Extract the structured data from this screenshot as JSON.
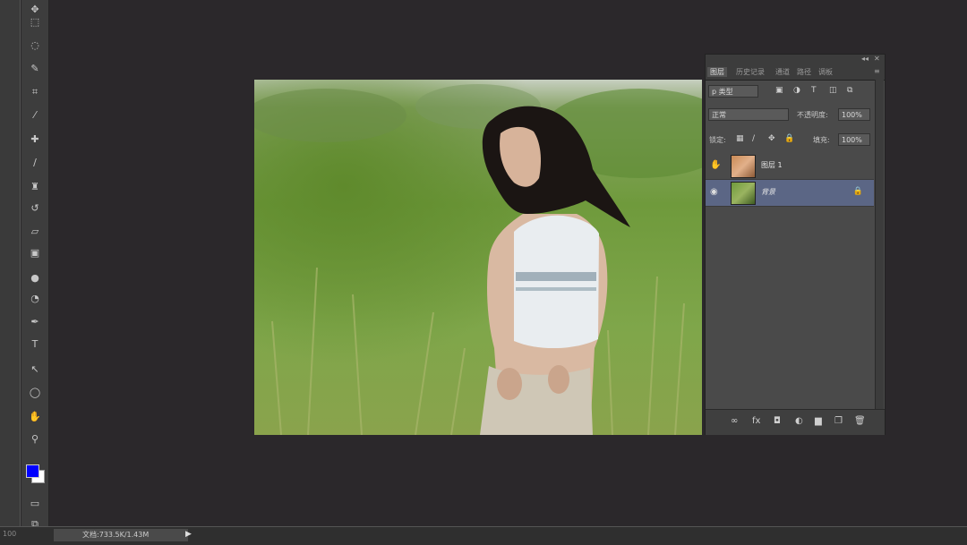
{
  "tools": [
    {
      "icon": "move-icon",
      "glyph": "✥"
    },
    {
      "icon": "marquee-icon",
      "glyph": "⬚"
    },
    {
      "icon": "lasso-icon",
      "glyph": "◌"
    },
    {
      "icon": "quick-select-icon",
      "glyph": "✎"
    },
    {
      "icon": "crop-icon",
      "glyph": "⌗"
    },
    {
      "icon": "eyedropper-icon",
      "glyph": "⁄"
    },
    {
      "icon": "spot-heal-icon",
      "glyph": "✚"
    },
    {
      "icon": "brush-icon",
      "glyph": "∕"
    },
    {
      "icon": "clone-stamp-icon",
      "glyph": "♜"
    },
    {
      "icon": "history-brush-icon",
      "glyph": "↺"
    },
    {
      "icon": "eraser-icon",
      "glyph": "▱"
    },
    {
      "icon": "gradient-icon",
      "glyph": "▣"
    },
    {
      "icon": "blur-icon",
      "glyph": "●"
    },
    {
      "icon": "dodge-icon",
      "glyph": "◔"
    },
    {
      "icon": "pen-icon",
      "glyph": "✒"
    },
    {
      "icon": "type-icon",
      "glyph": "T"
    },
    {
      "icon": "path-select-icon",
      "glyph": "↖"
    },
    {
      "icon": "shape-icon",
      "glyph": "◯"
    },
    {
      "icon": "hand-icon",
      "glyph": "✋"
    },
    {
      "icon": "zoom-icon",
      "glyph": "⚲"
    }
  ],
  "colors": {
    "foreground": "#0000ff",
    "background": "#ffffff",
    "selected_layer": "#5b6685"
  },
  "status": {
    "zoom": "100",
    "doc_info": "文档:733.5K/1.43M",
    "arrow": "▶"
  },
  "panel": {
    "win_minimize": "◂◂",
    "win_close": "✕",
    "tabs": [
      "图层",
      "历史记录",
      "通道",
      "路径",
      "调板"
    ],
    "kind_filter": "p 类型",
    "blend_mode": "正常",
    "opacity_label": "不透明度:",
    "opacity_value": "100%",
    "lock_label": "锁定:",
    "fill_label": "填充:",
    "fill_value": "100%",
    "layers": [
      {
        "name": "图层 1",
        "eye": "✋",
        "lock": "",
        "selected": false
      },
      {
        "name": "背景",
        "eye": "◉",
        "lock": "🔒",
        "selected": true
      }
    ],
    "bottom_icons": [
      "∞",
      "fx",
      "◘",
      "◐",
      "▆",
      "❐",
      "🗑"
    ]
  }
}
